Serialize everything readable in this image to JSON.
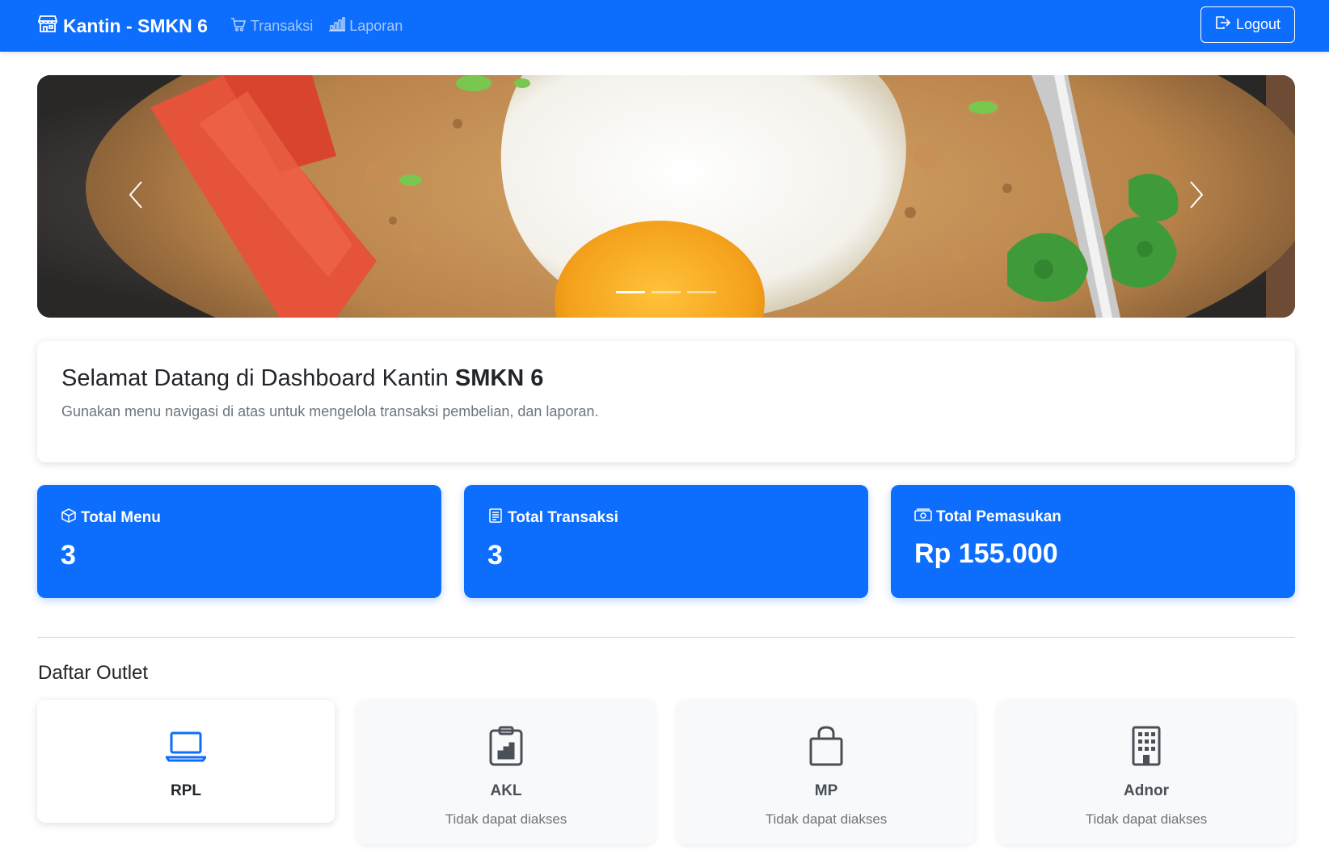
{
  "navbar": {
    "brand": "Kantin - SMKN 6",
    "links": [
      {
        "label": "Transaksi",
        "icon": "cart-icon"
      },
      {
        "label": "Laporan",
        "icon": "bar-chart-icon"
      }
    ],
    "logout_label": "Logout"
  },
  "carousel": {
    "active_slide": 1,
    "slide_count": 3
  },
  "welcome": {
    "title_prefix": "Selamat Datang di Dashboard Kantin ",
    "title_bold": "SMKN 6",
    "subtitle": "Gunakan menu navigasi di atas untuk mengelola transaksi pembelian, dan laporan."
  },
  "stats": [
    {
      "label": "Total Menu",
      "value": "3",
      "icon": "box-icon"
    },
    {
      "label": "Total Transaksi",
      "value": "3",
      "icon": "receipt-icon"
    },
    {
      "label": "Total Pemasukan",
      "value": "Rp 155.000",
      "icon": "cash-icon"
    }
  ],
  "outlets": {
    "title": "Daftar Outlet",
    "items": [
      {
        "name": "RPL",
        "note": "",
        "icon": "laptop-icon",
        "accessible": true
      },
      {
        "name": "AKL",
        "note": "Tidak dapat diakses",
        "icon": "clipboard-chart-icon",
        "accessible": false
      },
      {
        "name": "MP",
        "note": "Tidak dapat diakses",
        "icon": "bag-icon",
        "accessible": false
      },
      {
        "name": "Adnor",
        "note": "Tidak dapat diakses",
        "icon": "building-icon",
        "accessible": false
      }
    ]
  },
  "colors": {
    "primary": "#0d6efd",
    "muted": "#6c757d",
    "disabled_bg": "#f8f9fa"
  }
}
